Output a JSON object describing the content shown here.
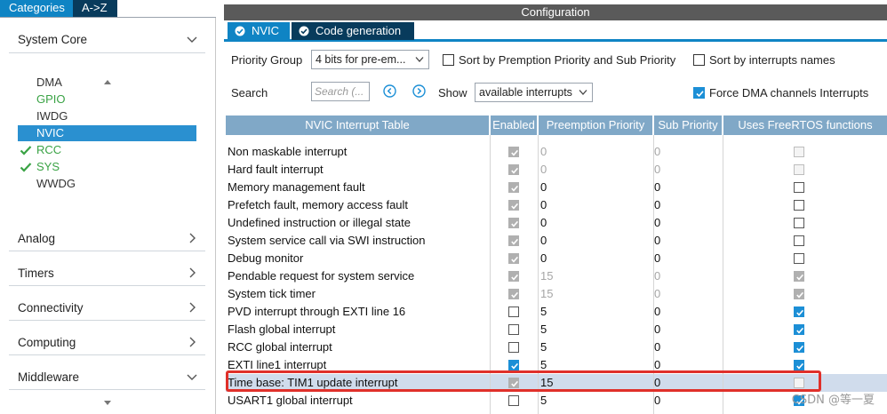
{
  "left_tabs": {
    "categories": "Categories",
    "az": "A->Z"
  },
  "sections_top": {
    "system_core": "System Core"
  },
  "system_core_items": [
    {
      "label": "DMA",
      "state": "normal"
    },
    {
      "label": "GPIO",
      "state": "green"
    },
    {
      "label": "IWDG",
      "state": "normal"
    },
    {
      "label": "NVIC",
      "state": "selected"
    },
    {
      "label": "RCC",
      "state": "green-check"
    },
    {
      "label": "SYS",
      "state": "green-check"
    },
    {
      "label": "WWDG",
      "state": "normal"
    }
  ],
  "sections": [
    {
      "label": "Analog",
      "chev": "right"
    },
    {
      "label": "Timers",
      "chev": "right"
    },
    {
      "label": "Connectivity",
      "chev": "right"
    },
    {
      "label": "Computing",
      "chev": "right"
    },
    {
      "label": "Middleware",
      "chev": "down"
    }
  ],
  "config_title": "Configuration",
  "right_tabs": {
    "nvic": "NVIC",
    "codegen": "Code generation"
  },
  "options": {
    "priority_group_label": "Priority Group",
    "priority_group_value": "4 bits for pre-em...",
    "sort_preemption_label": "Sort by Premption Priority and Sub Priority",
    "sort_names_label": "Sort by interrupts names",
    "search_label": "Search",
    "search_placeholder": "Search (...",
    "show_label": "Show",
    "show_value": "available interrupts",
    "force_dma_label": "Force DMA channels Interrupts"
  },
  "table_headers": {
    "name": "NVIC Interrupt Table",
    "enabled": "Enabled",
    "preemption": "Preemption Priority",
    "sub": "Sub Priority",
    "freertos": "Uses FreeRTOS functions"
  },
  "rows": [
    {
      "name": "Non maskable interrupt",
      "en": "ondis",
      "pre": "0",
      "pre_gray": true,
      "sub": "0",
      "sub_gray": true,
      "rtos": "dis"
    },
    {
      "name": "Hard fault interrupt",
      "en": "ondis",
      "pre": "0",
      "pre_gray": true,
      "sub": "0",
      "sub_gray": true,
      "rtos": "dis"
    },
    {
      "name": "Memory management fault",
      "en": "ondis",
      "pre": "0",
      "pre_gray": false,
      "sub": "0",
      "sub_gray": false,
      "rtos": "off"
    },
    {
      "name": "Prefetch fault, memory access fault",
      "en": "ondis",
      "pre": "0",
      "pre_gray": false,
      "sub": "0",
      "sub_gray": false,
      "rtos": "off"
    },
    {
      "name": "Undefined instruction or illegal state",
      "en": "ondis",
      "pre": "0",
      "pre_gray": false,
      "sub": "0",
      "sub_gray": false,
      "rtos": "off"
    },
    {
      "name": "System service call via SWI instruction",
      "en": "ondis",
      "pre": "0",
      "pre_gray": false,
      "sub": "0",
      "sub_gray": false,
      "rtos": "off"
    },
    {
      "name": "Debug monitor",
      "en": "ondis",
      "pre": "0",
      "pre_gray": false,
      "sub": "0",
      "sub_gray": false,
      "rtos": "off"
    },
    {
      "name": "Pendable request for system service",
      "en": "ondis",
      "pre": "15",
      "pre_gray": true,
      "sub": "0",
      "sub_gray": true,
      "rtos": "ondis"
    },
    {
      "name": "System tick timer",
      "en": "ondis",
      "pre": "15",
      "pre_gray": true,
      "sub": "0",
      "sub_gray": true,
      "rtos": "ondis"
    },
    {
      "name": "PVD interrupt through EXTI line 16",
      "en": "off",
      "pre": "5",
      "pre_gray": false,
      "sub": "0",
      "sub_gray": false,
      "rtos": "on"
    },
    {
      "name": "Flash global interrupt",
      "en": "off",
      "pre": "5",
      "pre_gray": false,
      "sub": "0",
      "sub_gray": false,
      "rtos": "on"
    },
    {
      "name": "RCC global interrupt",
      "en": "off",
      "pre": "5",
      "pre_gray": false,
      "sub": "0",
      "sub_gray": false,
      "rtos": "on"
    },
    {
      "name": "EXTI line1 interrupt",
      "en": "on",
      "pre": "5",
      "pre_gray": false,
      "sub": "0",
      "sub_gray": false,
      "rtos": "on"
    },
    {
      "name": "Time base: TIM1 update interrupt",
      "en": "ondis",
      "pre": "15",
      "pre_gray": false,
      "sub": "0",
      "sub_gray": false,
      "rtos": "dis",
      "highlight": true
    },
    {
      "name": "USART1 global interrupt",
      "en": "off",
      "pre": "5",
      "pre_gray": false,
      "sub": "0",
      "sub_gray": false,
      "rtos": "on"
    }
  ],
  "watermark": "CSDN @等一夏",
  "colors": {
    "accent": "#0f84c4",
    "dark_tab": "#083b5c",
    "header": "#80a8c7",
    "highlight_box": "#e0302a",
    "green": "#3aa345"
  }
}
